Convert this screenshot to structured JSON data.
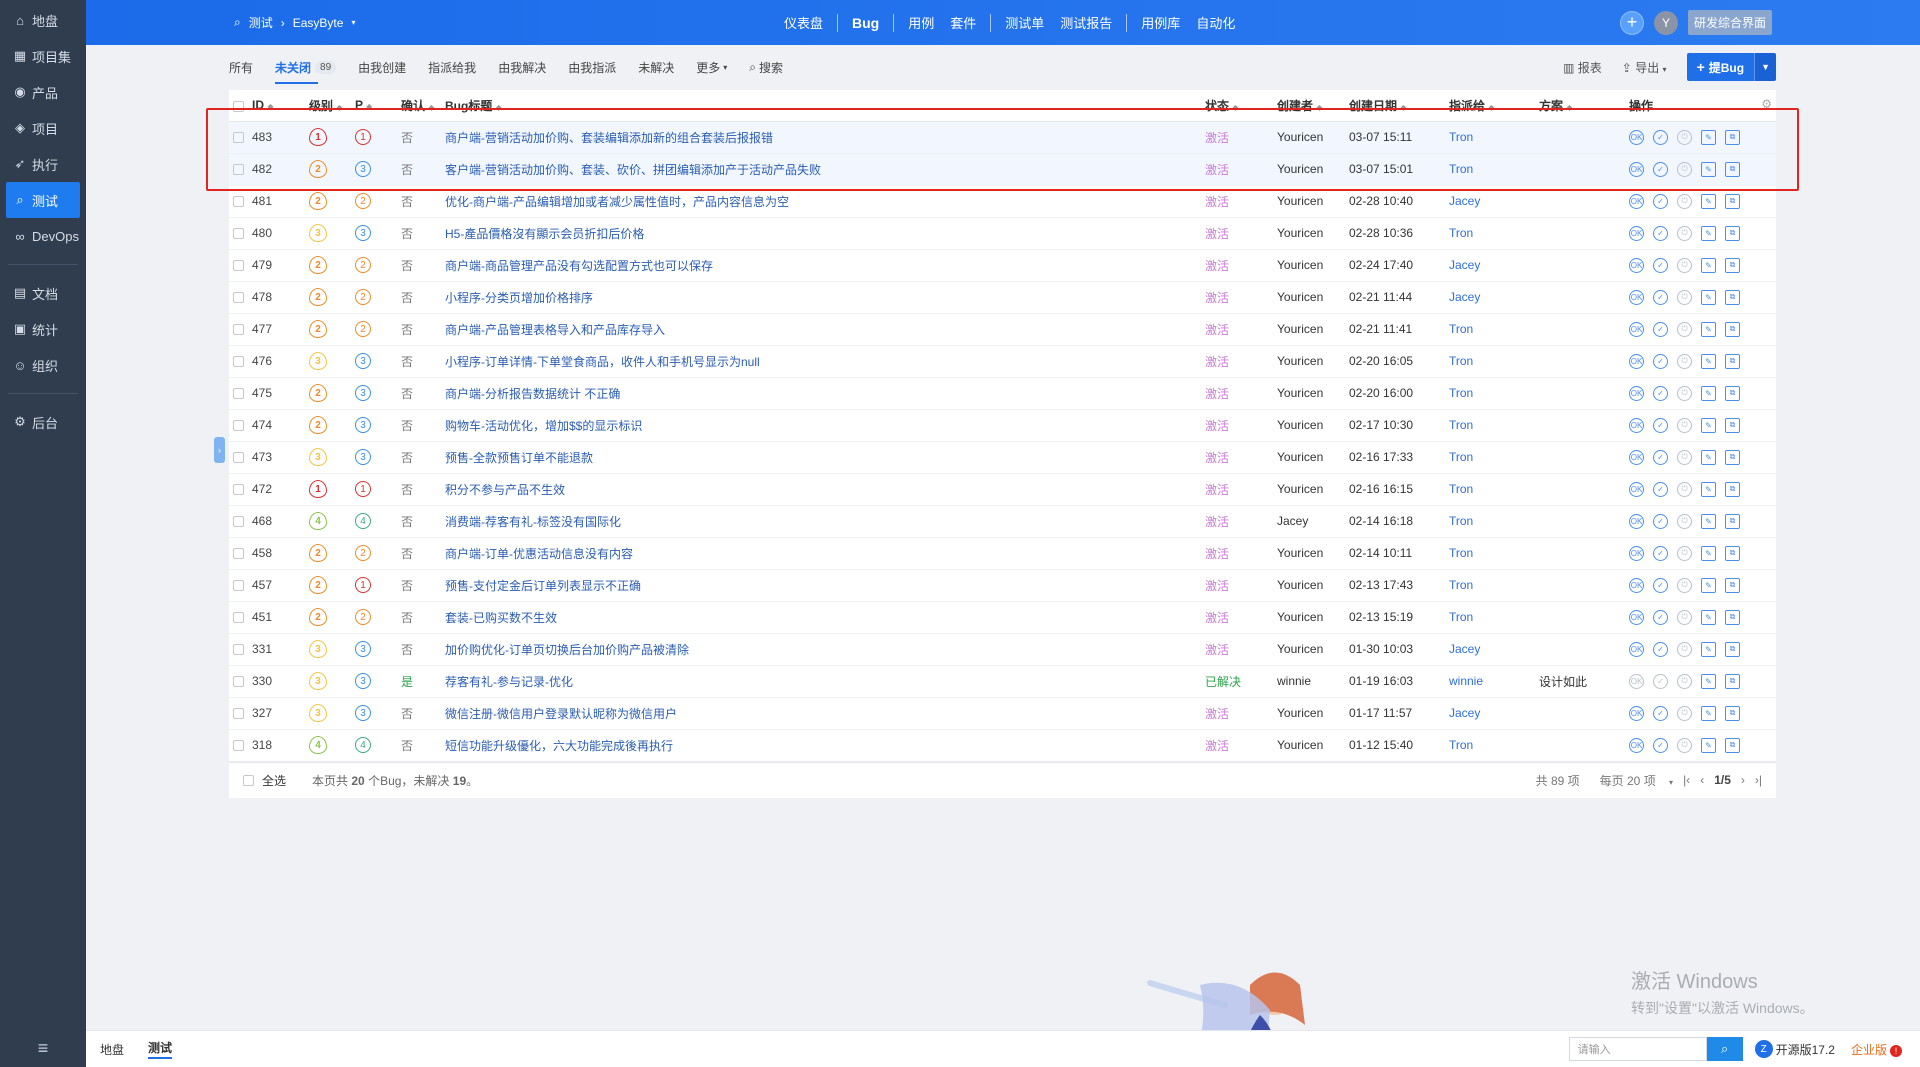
{
  "sidebar": {
    "items": [
      {
        "label": "地盘",
        "icon": "home-icon"
      },
      {
        "label": "项目集",
        "icon": "grid-icon"
      },
      {
        "label": "产品",
        "icon": "lightbulb-icon"
      },
      {
        "label": "项目",
        "icon": "project-icon"
      },
      {
        "label": "执行",
        "icon": "run-icon"
      },
      {
        "label": "测试",
        "icon": "search-icon"
      },
      {
        "label": "DevOps",
        "icon": "infinity-icon"
      },
      {
        "label": "文档",
        "icon": "doc-icon"
      },
      {
        "label": "统计",
        "icon": "chart-icon"
      },
      {
        "label": "组织",
        "icon": "user-icon"
      },
      {
        "label": "后台",
        "icon": "gear-icon"
      }
    ]
  },
  "header": {
    "module": "测试",
    "product": "EasyByte",
    "nav": [
      "仪表盘",
      "Bug",
      "用例",
      "套件",
      "测试单",
      "测试报告",
      "用例库",
      "自动化"
    ],
    "active_nav": "Bug",
    "avatar_letter": "Y",
    "switch_label": "研发综合界面"
  },
  "subnav": {
    "tabs": [
      "所有",
      "未关闭",
      "由我创建",
      "指派给我",
      "由我解决",
      "由我指派",
      "未解决",
      "更多"
    ],
    "active": "未关闭",
    "unclosed_count": "89",
    "search_label": "搜索",
    "report_label": "报表",
    "export_label": "导出",
    "add_bug_label": "提Bug"
  },
  "table": {
    "columns": [
      "ID",
      "级别",
      "P",
      "确认",
      "Bug标题",
      "状态",
      "创建者",
      "创建日期",
      "指派给",
      "方案",
      "操作"
    ],
    "rows": [
      {
        "id": "483",
        "sev": "1",
        "pri": "1",
        "confirm": "否",
        "title": "商户端-营销活动加价购、套装编辑添加新的组合套装后报报错",
        "status": "激活",
        "creator": "Youricen",
        "date": "03-07 15:11",
        "assignee": "Tron",
        "solution": ""
      },
      {
        "id": "482",
        "sev": "2",
        "pri": "3",
        "confirm": "否",
        "title": "客户端-营销活动加价购、套装、砍价、拼团编辑添加产于活动产品失败",
        "status": "激活",
        "creator": "Youricen",
        "date": "03-07 15:01",
        "assignee": "Tron",
        "solution": ""
      },
      {
        "id": "481",
        "sev": "2",
        "pri": "2",
        "confirm": "否",
        "title": "优化-商户端-产品编辑增加或者减少属性值时，产品内容信息为空",
        "status": "激活",
        "creator": "Youricen",
        "date": "02-28 10:40",
        "assignee": "Jacey",
        "solution": ""
      },
      {
        "id": "480",
        "sev": "3",
        "pri": "3",
        "confirm": "否",
        "title": "H5-產品價格沒有顯示会员折扣后价格",
        "status": "激活",
        "creator": "Youricen",
        "date": "02-28 10:36",
        "assignee": "Tron",
        "solution": ""
      },
      {
        "id": "479",
        "sev": "2",
        "pri": "2",
        "confirm": "否",
        "title": "商户端-商品管理产品没有勾选配置方式也可以保存",
        "status": "激活",
        "creator": "Youricen",
        "date": "02-24 17:40",
        "assignee": "Jacey",
        "solution": ""
      },
      {
        "id": "478",
        "sev": "2",
        "pri": "2",
        "confirm": "否",
        "title": "小程序-分类页增加价格排序",
        "status": "激活",
        "creator": "Youricen",
        "date": "02-21 11:44",
        "assignee": "Jacey",
        "solution": ""
      },
      {
        "id": "477",
        "sev": "2",
        "pri": "2",
        "confirm": "否",
        "title": "商户端-产品管理表格导入和产品库存导入",
        "status": "激活",
        "creator": "Youricen",
        "date": "02-21 11:41",
        "assignee": "Tron",
        "solution": ""
      },
      {
        "id": "476",
        "sev": "3",
        "pri": "3",
        "confirm": "否",
        "title": "小程序-订单详情-下单堂食商品，收件人和手机号显示为null",
        "status": "激活",
        "creator": "Youricen",
        "date": "02-20 16:05",
        "assignee": "Tron",
        "solution": ""
      },
      {
        "id": "475",
        "sev": "2",
        "pri": "3",
        "confirm": "否",
        "title": "商户端-分析报告数据统计 不正确",
        "status": "激活",
        "creator": "Youricen",
        "date": "02-20 16:00",
        "assignee": "Tron",
        "solution": ""
      },
      {
        "id": "474",
        "sev": "2",
        "pri": "3",
        "confirm": "否",
        "title": "购物车-活动优化，增加$$的显示标识",
        "status": "激活",
        "creator": "Youricen",
        "date": "02-17 10:30",
        "assignee": "Tron",
        "solution": ""
      },
      {
        "id": "473",
        "sev": "3",
        "pri": "3",
        "confirm": "否",
        "title": "预售-全款预售订单不能退款",
        "status": "激活",
        "creator": "Youricen",
        "date": "02-16 17:33",
        "assignee": "Tron",
        "solution": ""
      },
      {
        "id": "472",
        "sev": "1",
        "pri": "1",
        "confirm": "否",
        "title": "积分不参与产品不生效",
        "status": "激活",
        "creator": "Youricen",
        "date": "02-16 16:15",
        "assignee": "Tron",
        "solution": ""
      },
      {
        "id": "468",
        "sev": "4",
        "pri": "4",
        "confirm": "否",
        "title": "消费端-荐客有礼-标签没有国际化",
        "status": "激活",
        "creator": "Jacey",
        "date": "02-14 16:18",
        "assignee": "Tron",
        "solution": ""
      },
      {
        "id": "458",
        "sev": "2",
        "pri": "2",
        "confirm": "否",
        "title": "商户端-订单-优惠活动信息没有内容",
        "status": "激活",
        "creator": "Youricen",
        "date": "02-14 10:11",
        "assignee": "Tron",
        "solution": ""
      },
      {
        "id": "457",
        "sev": "2",
        "pri": "1",
        "confirm": "否",
        "title": "预售-支付定金后订单列表显示不正确",
        "status": "激活",
        "creator": "Youricen",
        "date": "02-13 17:43",
        "assignee": "Tron",
        "solution": ""
      },
      {
        "id": "451",
        "sev": "2",
        "pri": "2",
        "confirm": "否",
        "title": "套装-已购买数不生效",
        "status": "激活",
        "creator": "Youricen",
        "date": "02-13 15:19",
        "assignee": "Tron",
        "solution": ""
      },
      {
        "id": "331",
        "sev": "3",
        "pri": "3",
        "confirm": "否",
        "title": "加价购优化-订单页切换后台加价购产品被清除",
        "status": "激活",
        "creator": "Youricen",
        "date": "01-30 10:03",
        "assignee": "Jacey",
        "solution": ""
      },
      {
        "id": "330",
        "sev": "3",
        "pri": "3",
        "confirm": "是",
        "title": "荐客有礼-参与记录-优化",
        "status": "已解决",
        "creator": "winnie",
        "date": "01-19 16:03",
        "assignee": "winnie",
        "solution": "设计如此"
      },
      {
        "id": "327",
        "sev": "3",
        "pri": "3",
        "confirm": "否",
        "title": "微信注册-微信用户登录默认昵称为微信用户",
        "status": "激活",
        "creator": "Youricen",
        "date": "01-17 11:57",
        "assignee": "Jacey",
        "solution": ""
      },
      {
        "id": "318",
        "sev": "4",
        "pri": "4",
        "confirm": "否",
        "title": "短信功能升级優化，六大功能完成後再执行",
        "status": "激活",
        "creator": "Youricen",
        "date": "01-12 15:40",
        "assignee": "Tron",
        "solution": ""
      }
    ]
  },
  "table_footer": {
    "select_all": "全选",
    "summary_prefix": "本页共",
    "summary_count": "20",
    "summary_mid": "个Bug，未解决",
    "summary_unresolved": "19",
    "summary_end": "。",
    "total": "共 89 项",
    "per_page": "每页 20 项",
    "page": "1/5"
  },
  "footer": {
    "links": [
      "地盘",
      "测试"
    ],
    "search_placeholder": "请输入",
    "version": "开源版17.2",
    "enterprise": "企业版"
  },
  "watermark": {
    "line1": "激活 Windows",
    "line2": "转到\"设置\"以激活 Windows。"
  },
  "colors": {
    "sev": {
      "1": "#d9302c",
      "2": "#f08a24",
      "3": "#f5c242",
      "4": "#8bc34a"
    },
    "pri": {
      "1": "#d9302c",
      "2": "#f08a24",
      "3": "#3a8fe0",
      "4": "#3aa87a"
    },
    "accent": "#1f6fe8"
  }
}
